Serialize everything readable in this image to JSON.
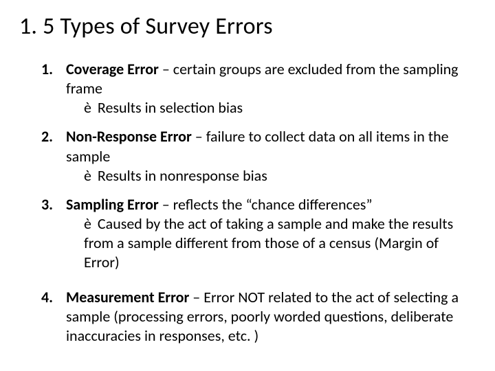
{
  "title": "1. 5 Types of Survey Errors",
  "items": [
    {
      "term": "Coverage Error",
      "sep": " – ",
      "desc": "certain groups are excluded from the sampling frame",
      "arrow_prefix": "è",
      "arrow_text": " Results in selection bias"
    },
    {
      "term": "Non-Response Error",
      "sep": " – ",
      "desc": "failure to  collect data on all items in the sample",
      "arrow_prefix": "è",
      "arrow_text": " Results in nonresponse bias"
    },
    {
      "term": "Sampling Error",
      "sep": " – ",
      "desc": "reflects the “chance differences”",
      "arrow_prefix": "è",
      "arrow_text": " Caused by the act of taking a sample and make the results from a sample different from those of a census (Margin of Error)"
    },
    {
      "term": "Measurement Error",
      "sep": " – ",
      "desc": "Error NOT related to the act of selecting a sample (processing errors, poorly worded questions, deliberate inaccuracies in responses, etc. )",
      "arrow_prefix": "",
      "arrow_text": ""
    }
  ]
}
